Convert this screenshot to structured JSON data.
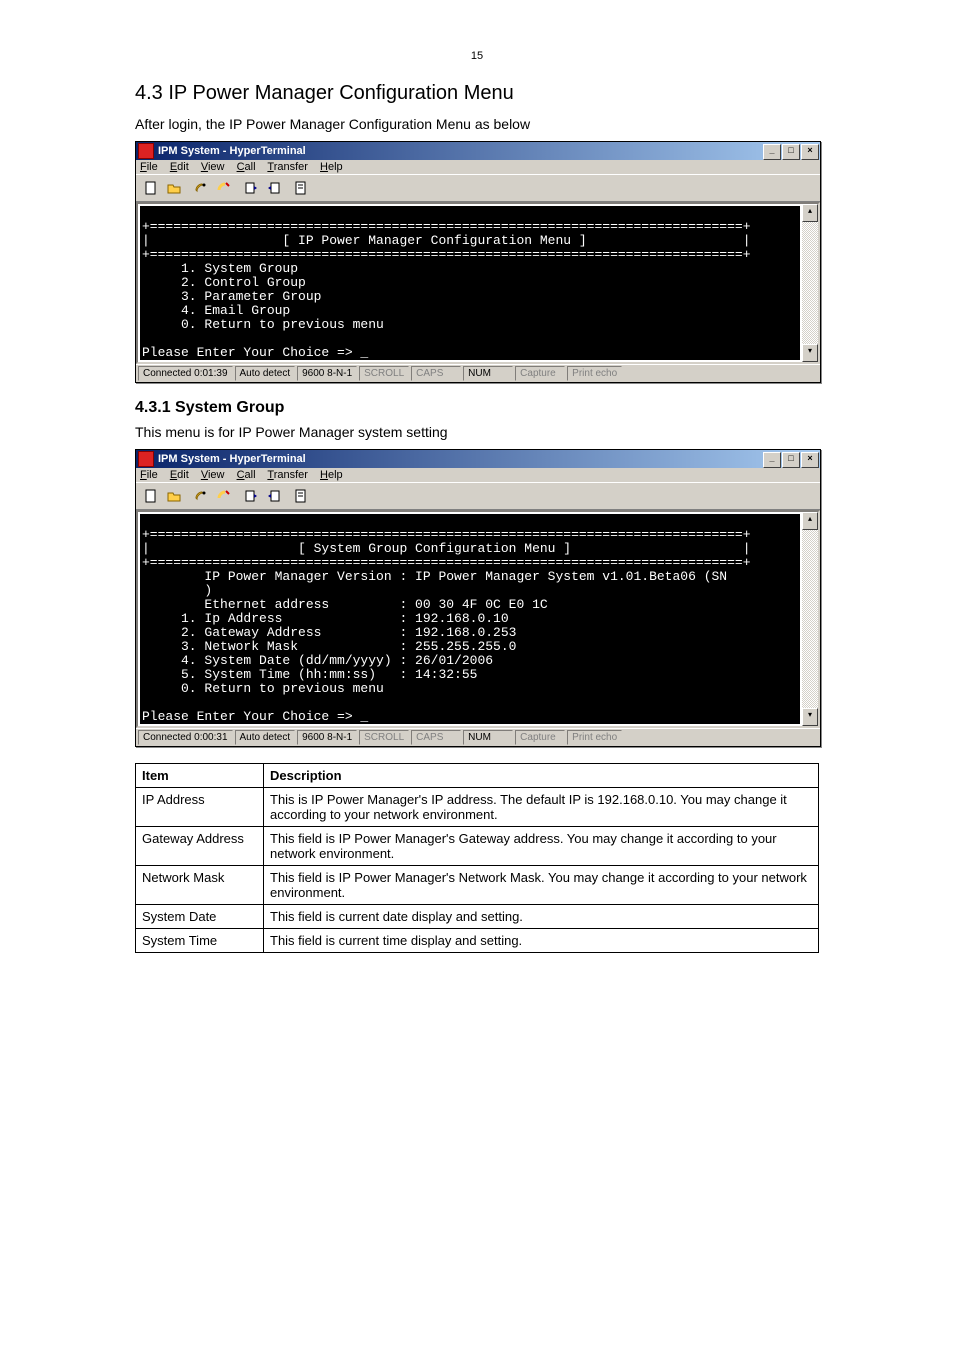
{
  "page_number": "15",
  "heading_main": "4.3 IP Power Manager Configuration Menu",
  "intro_text": "After login, the IP Power Manager Configuration Menu as below",
  "ht_title": "IPM System - HyperTerminal",
  "menus": {
    "file": "File",
    "edit": "Edit",
    "view": "View",
    "call": "Call",
    "transfer": "Transfer",
    "help": "Help"
  },
  "win_buttons": {
    "min": "_",
    "max": "□",
    "close": "×"
  },
  "scroll_up": "▴",
  "scroll_down": "▾",
  "status": {
    "conn1": "Connected 0:01:39",
    "conn2": "Connected 0:00:31",
    "detect": "Auto detect",
    "baud": "9600 8-N-1",
    "scroll": "SCROLL",
    "caps": "CAPS",
    "num": "NUM",
    "capture": "Capture",
    "echo": "Print echo"
  },
  "terminal1_lines": [
    "",
    "+============================================================================+",
    "|                 [ IP Power Manager Configuration Menu ]                    |",
    "+============================================================================+",
    "     1. System Group",
    "     2. Control Group",
    "     3. Parameter Group",
    "     4. Email Group",
    "     0. Return to previous menu",
    "",
    "Please Enter Your Choice => _"
  ],
  "heading_sub": "4.3.1 System Group",
  "sub_intro": "This menu is for IP Power Manager system setting",
  "terminal2_lines": [
    "",
    "+============================================================================+",
    "|                   [ System Group Configuration Menu ]                      |",
    "+============================================================================+",
    "        IP Power Manager Version : IP Power Manager System v1.01.Beta06 (SN",
    "        )",
    "        Ethernet address         : 00 30 4F 0C E0 1C",
    "     1. Ip Address               : 192.168.0.10",
    "     2. Gateway Address          : 192.168.0.253",
    "     3. Network Mask             : 255.255.255.0",
    "     4. System Date (dd/mm/yyyy) : 26/01/2006",
    "     5. System Time (hh:mm:ss)   : 14:32:55",
    "     0. Return to previous menu",
    "",
    "Please Enter Your Choice => _"
  ],
  "table": {
    "header_item": "Item",
    "header_desc": "Description",
    "rows": [
      {
        "item": "IP Address",
        "desc": "This is IP Power Manager's IP address. The default IP is 192.168.0.10. You may change it according to your network environment."
      },
      {
        "item": "Gateway Address",
        "desc": "This field is IP Power Manager's Gateway address. You may change it according to your network environment."
      },
      {
        "item": "Network Mask",
        "desc": "This field is IP Power Manager's Network Mask. You may change it according to your network environment."
      },
      {
        "item": "System Date",
        "desc": "This field is current date display and setting."
      },
      {
        "item": "System Time",
        "desc": "This field is current time display and setting."
      }
    ]
  }
}
